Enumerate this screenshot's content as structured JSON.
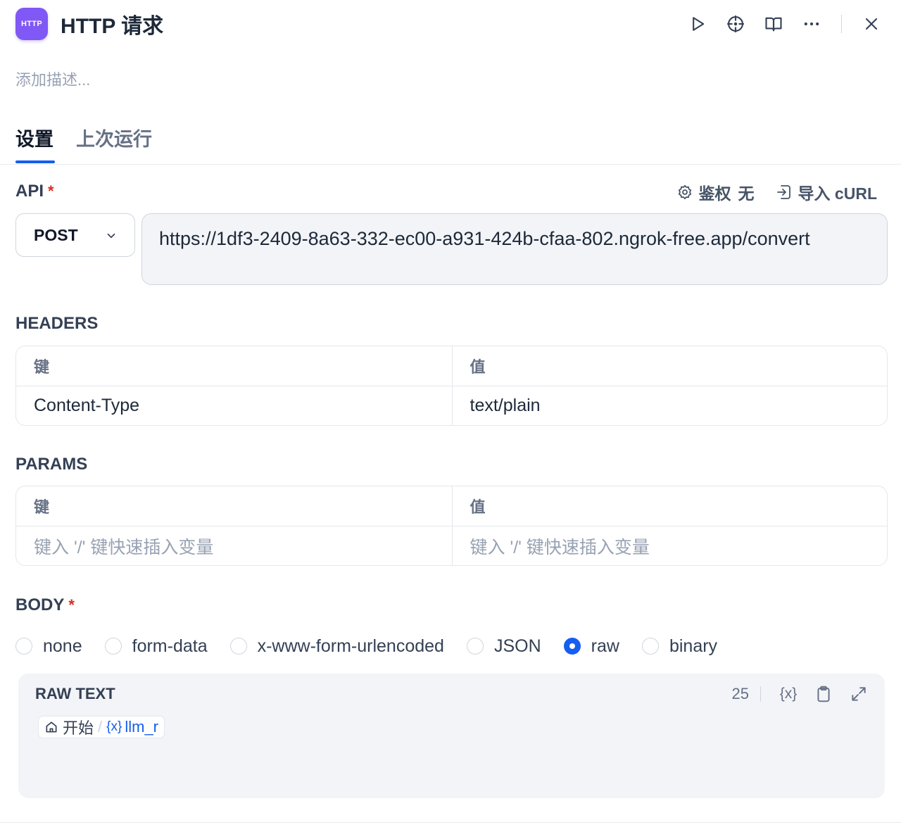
{
  "header": {
    "badge": "HTTP",
    "title": "HTTP 请求",
    "actions": [
      "play-icon",
      "locate-icon",
      "book-icon",
      "more-icon",
      "close-icon"
    ]
  },
  "description_placeholder": "添加描述...",
  "tabs": [
    {
      "label": "设置",
      "active": true
    },
    {
      "label": "上次运行",
      "active": false
    }
  ],
  "api": {
    "label": "API",
    "required_mark": "*",
    "auth_label": "鉴权",
    "auth_value": "无",
    "import_label": "导入 cURL",
    "method": "POST",
    "url": "https://1df3-2409-8a63-332-ec00-a931-424b-cfaa-802.ngrok-free.app/convert"
  },
  "headers": {
    "label": "HEADERS",
    "key_header": "键",
    "value_header": "值",
    "rows": [
      {
        "key": "Content-Type",
        "value": "text/plain"
      }
    ]
  },
  "params": {
    "label": "PARAMS",
    "key_header": "键",
    "value_header": "值",
    "key_placeholder": "键入 '/' 键快速插入变量",
    "value_placeholder": "键入 '/' 键快速插入变量"
  },
  "body": {
    "label": "BODY",
    "required_mark": "*",
    "options": [
      "none",
      "form-data",
      "x-www-form-urlencoded",
      "JSON",
      "raw",
      "binary"
    ],
    "selected": "raw",
    "raw": {
      "title": "RAW TEXT",
      "count": "25",
      "var_button": "{x}",
      "chip": {
        "node": "开始",
        "separator": "/",
        "var_prefix": "{x}",
        "var": "llm_r"
      }
    }
  },
  "colors": {
    "accent": "#155eef",
    "badge": "#8058f5",
    "required": "#d92d20"
  }
}
